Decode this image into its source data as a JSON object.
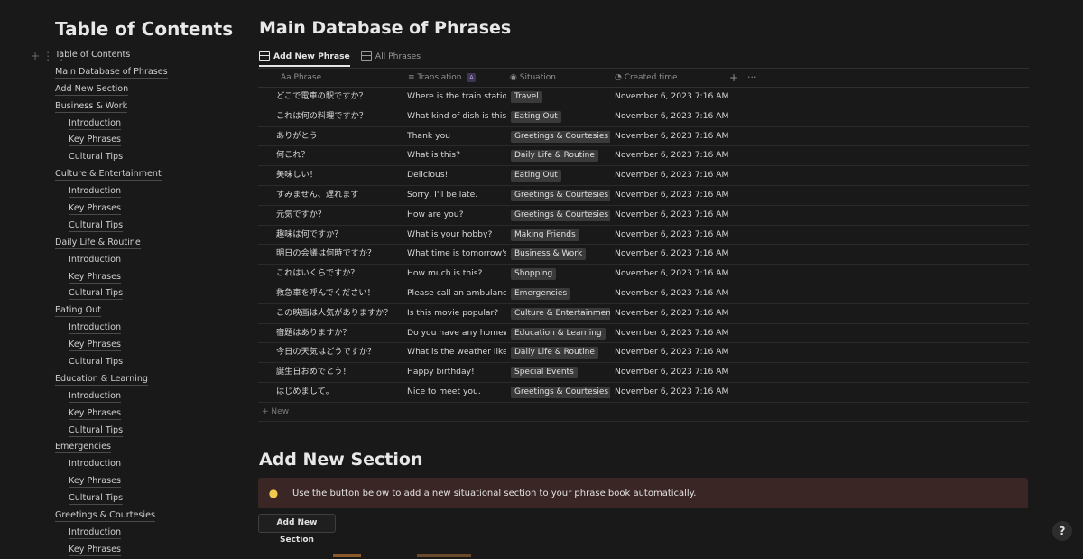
{
  "toc": {
    "title": "Table of Contents",
    "items": [
      {
        "label": "Table of Contents",
        "level": 0
      },
      {
        "label": "Main Database of Phrases",
        "level": 0
      },
      {
        "label": "Add New Section",
        "level": 0
      },
      {
        "label": "Business & Work",
        "level": 0
      },
      {
        "label": "Introduction",
        "level": 1
      },
      {
        "label": "Key Phrases",
        "level": 1
      },
      {
        "label": "Cultural Tips",
        "level": 1
      },
      {
        "label": "Culture & Entertainment",
        "level": 0
      },
      {
        "label": "Introduction",
        "level": 1
      },
      {
        "label": "Key Phrases",
        "level": 1
      },
      {
        "label": "Cultural Tips",
        "level": 1
      },
      {
        "label": "Daily Life & Routine",
        "level": 0
      },
      {
        "label": "Introduction",
        "level": 1
      },
      {
        "label": "Key Phrases",
        "level": 1
      },
      {
        "label": "Cultural Tips",
        "level": 1
      },
      {
        "label": "Eating Out",
        "level": 0
      },
      {
        "label": "Introduction",
        "level": 1
      },
      {
        "label": "Key Phrases",
        "level": 1
      },
      {
        "label": "Cultural Tips",
        "level": 1
      },
      {
        "label": "Education & Learning",
        "level": 0
      },
      {
        "label": "Introduction",
        "level": 1
      },
      {
        "label": "Key Phrases",
        "level": 1
      },
      {
        "label": "Cultural Tips",
        "level": 1
      },
      {
        "label": "Emergencies",
        "level": 0
      },
      {
        "label": "Introduction",
        "level": 1
      },
      {
        "label": "Key Phrases",
        "level": 1
      },
      {
        "label": "Cultural Tips",
        "level": 1
      },
      {
        "label": "Greetings & Courtesies",
        "level": 0
      },
      {
        "label": "Introduction",
        "level": 1
      },
      {
        "label": "Key Phrases",
        "level": 1
      }
    ]
  },
  "main": {
    "title": "Main Database of Phrases",
    "tabs": [
      {
        "label": "Add New Phrase",
        "active": true
      },
      {
        "label": "All Phrases",
        "active": false
      }
    ],
    "columns": {
      "phrase": "Aa Phrase",
      "translation": "Translation",
      "translation_badge": "A",
      "situation": "Situation",
      "created": "Created time"
    },
    "rows": [
      {
        "phrase": "どこで電車の駅ですか？",
        "translation": "Where is the train station?",
        "situation": "Travel",
        "created": "November 6, 2023 7:16 AM"
      },
      {
        "phrase": "これは何の料理ですか？",
        "translation": "What kind of dish is this?",
        "situation": "Eating Out",
        "created": "November 6, 2023 7:16 AM"
      },
      {
        "phrase": "ありがとう",
        "translation": "Thank you",
        "situation": "Greetings & Courtesies",
        "created": "November 6, 2023 7:16 AM"
      },
      {
        "phrase": "何これ？",
        "translation": "What is this?",
        "situation": "Daily Life & Routine",
        "created": "November 6, 2023 7:16 AM"
      },
      {
        "phrase": "美味しい！",
        "translation": "Delicious!",
        "situation": "Eating Out",
        "created": "November 6, 2023 7:16 AM"
      },
      {
        "phrase": "すみません、遅れます",
        "translation": "Sorry, I'll be late.",
        "situation": "Greetings & Courtesies",
        "created": "November 6, 2023 7:16 AM"
      },
      {
        "phrase": "元気ですか？",
        "translation": "How are you?",
        "situation": "Greetings & Courtesies",
        "created": "November 6, 2023 7:16 AM"
      },
      {
        "phrase": "趣味は何ですか？",
        "translation": "What is your hobby?",
        "situation": "Making Friends",
        "created": "November 6, 2023 7:16 AM"
      },
      {
        "phrase": "明日の会議は何時ですか？",
        "translation": "What time is tomorrow's me",
        "situation": "Business & Work",
        "created": "November 6, 2023 7:16 AM"
      },
      {
        "phrase": "これはいくらですか？",
        "translation": "How much is this?",
        "situation": "Shopping",
        "created": "November 6, 2023 7:16 AM"
      },
      {
        "phrase": "救急車を呼んでください！",
        "translation": "Please call an ambulance!",
        "situation": "Emergencies",
        "created": "November 6, 2023 7:16 AM"
      },
      {
        "phrase": "この映画は人気がありますか？",
        "translation": "Is this movie popular?",
        "situation": "Culture & Entertainment",
        "created": "November 6, 2023 7:16 AM"
      },
      {
        "phrase": "宿題はありますか？",
        "translation": "Do you have any homework",
        "situation": "Education & Learning",
        "created": "November 6, 2023 7:16 AM"
      },
      {
        "phrase": "今日の天気はどうですか？",
        "translation": "What is the weather like tod",
        "situation": "Daily Life & Routine",
        "created": "November 6, 2023 7:16 AM"
      },
      {
        "phrase": "誕生日おめでとう！",
        "translation": "Happy birthday!",
        "situation": "Special Events",
        "created": "November 6, 2023 7:16 AM"
      },
      {
        "phrase": "はじめまして。",
        "translation": "Nice to meet you.",
        "situation": "Greetings & Courtesies",
        "created": "November 6, 2023 7:16 AM"
      }
    ],
    "new_label": "New"
  },
  "section": {
    "title": "Add New Section",
    "callout_text": "Use the button below to add a new situational section to your phrase book automatically.",
    "button_label": "Add New Section"
  },
  "help_label": "?",
  "icons": {
    "toc_add": "plus-icon",
    "toc_drag": "drag-handle-icon",
    "tab_table": "table-icon",
    "translation_col": "text-lines-icon",
    "situation_col": "select-icon",
    "created_col": "clock-icon",
    "add_column": "plus-icon",
    "more": "more-icon",
    "callout": "lightbulb-icon"
  },
  "colors": {
    "background": "#191919",
    "tag": "#3a3a3a",
    "callout_bg": "#3a2624",
    "ai_badge": "#3d3456"
  }
}
